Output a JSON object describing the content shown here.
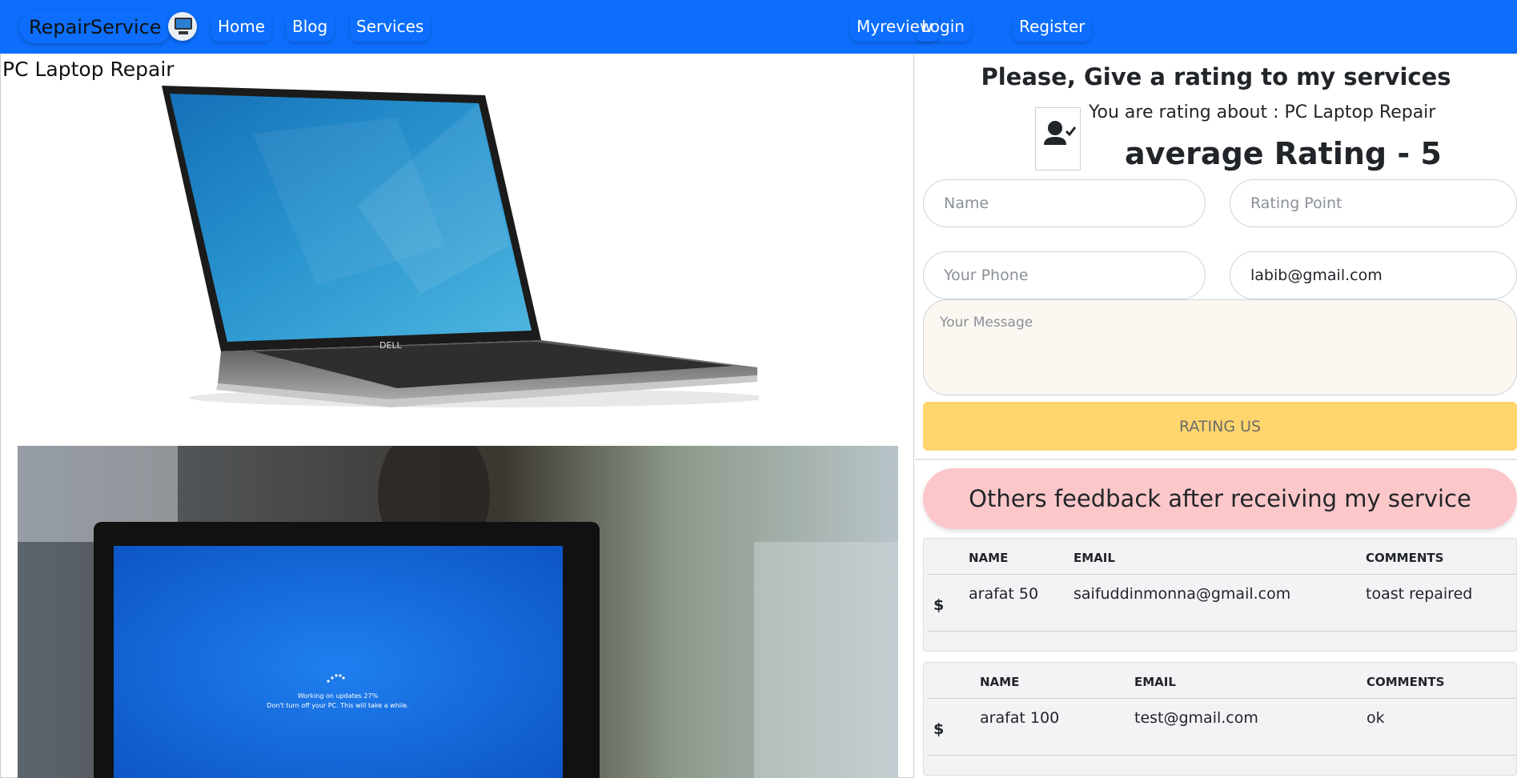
{
  "navbar": {
    "brand": "RepairService",
    "links": [
      "Home",
      "Blog",
      "Services"
    ],
    "right_links": [
      "Myreview",
      "Login",
      "Register"
    ],
    "color": "#0d6efd"
  },
  "service": {
    "title": "PC Laptop Repair",
    "photo_text_line1": "Working on updates  27%",
    "photo_text_line2": "Don't turn off your PC. This will take a while.",
    "laptop_brand_text": "DELL"
  },
  "rating": {
    "heading": "Please, Give a rating to my services",
    "about": "You are rating about : PC Laptop Repair",
    "average": "average Rating - 5",
    "name_placeholder": "Name",
    "rating_placeholder": "Rating Point",
    "phone_placeholder": "Your Phone",
    "email_value": "labib@gmail.com",
    "message_placeholder": "Your Message",
    "button": "RATING US",
    "button_color": "#fed66d"
  },
  "feedback": {
    "heading": "Others feedback after receiving my service",
    "headers": [
      "NAME",
      "EMAIL",
      "COMMENTS"
    ],
    "entries": [
      {
        "symbol": "$",
        "name": "arafat 50",
        "email": "saifuddinmonna@gmail.com",
        "comment": "toast repaired"
      },
      {
        "symbol": "$",
        "name": "arafat 100",
        "email": "test@gmail.com",
        "comment": "ok"
      }
    ]
  }
}
